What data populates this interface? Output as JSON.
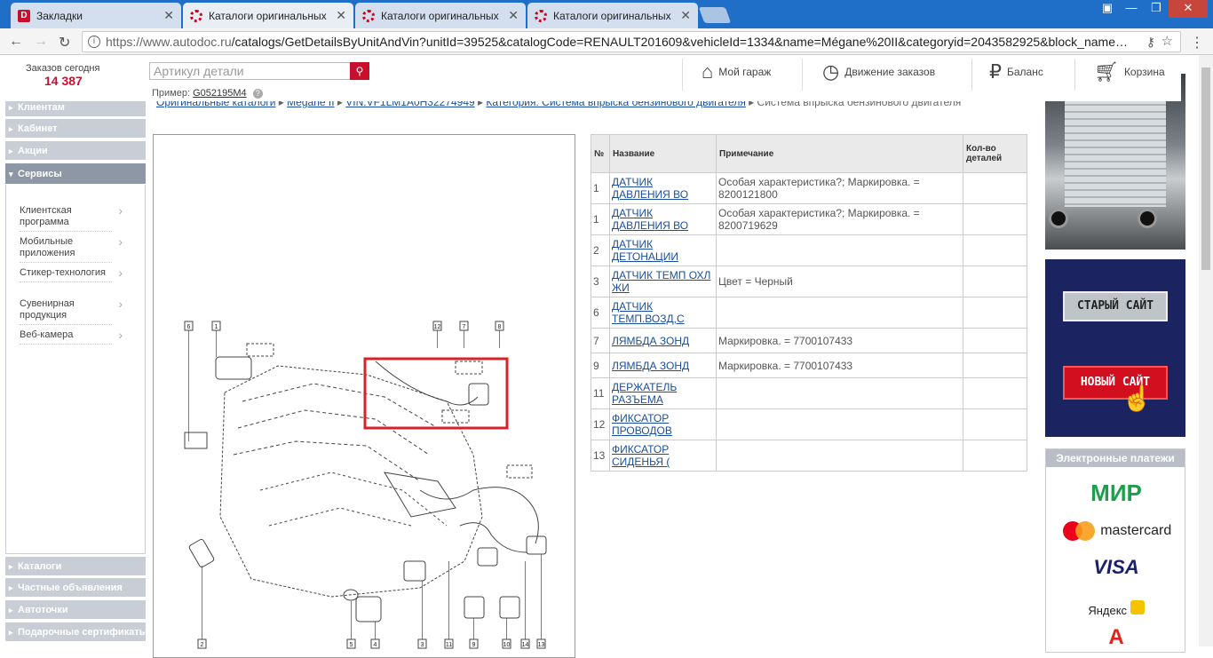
{
  "browser": {
    "tabs": [
      {
        "title": "Закладки",
        "favicon": "d-icon",
        "active": false
      },
      {
        "title": "Каталоги оригинальных",
        "favicon": "autodoc-icon",
        "active": true
      },
      {
        "title": "Каталоги оригинальных",
        "favicon": "autodoc-icon",
        "active": false
      },
      {
        "title": "Каталоги оригинальных",
        "favicon": "autodoc-icon",
        "active": false
      }
    ],
    "url_domain": "https://www.autodoc.ru",
    "url_path": "/catalogs/GetDetailsByUnitAndVin?unitId=39525&catalogCode=RENAULT201609&vehicleId=1334&name=Mégane%20II&categoryid=2043582925&block_name…"
  },
  "header": {
    "orders_label": "Заказов сегодня",
    "orders_count": "14 387",
    "search_placeholder": "Артикул детали",
    "example_label": "Пример:",
    "example_value": "G052195M4",
    "links": [
      {
        "label": "Мой гараж",
        "icon": "garage-icon"
      },
      {
        "label": "Движение заказов",
        "icon": "orders-clock-icon"
      },
      {
        "label": "Баланс",
        "icon": "wallet-icon"
      },
      {
        "label": "Корзина",
        "icon": "cart-icon"
      }
    ]
  },
  "sidebar": {
    "top_sections": [
      "Клиентам",
      "Кабинет",
      "Акции",
      "Сервисы"
    ],
    "service_items": [
      "Клиентская программа",
      "Мобильные приложения",
      "Стикер-технология",
      "Сувенирная продукция",
      "Веб-камера"
    ],
    "bottom_sections": [
      "Каталоги",
      "Частные объявления",
      "Автоточки",
      "Подарочные сертификаты"
    ]
  },
  "breadcrumb": {
    "items": [
      "Оригинальные каталоги",
      "Mégane II",
      "VIN:VF1LM1A0H32274949",
      "Категория: Система впрыска бензинового двигателя"
    ],
    "current": "Система впрыска бензинового двигателя"
  },
  "diagram": {
    "callouts": [
      "6",
      "1",
      "12",
      "7",
      "8",
      "2",
      "5",
      "4",
      "3",
      "11",
      "9",
      "10",
      "14",
      "13"
    ]
  },
  "table": {
    "headers": [
      "№",
      "Название",
      "Примечание",
      "Кол-во деталей"
    ],
    "rows": [
      {
        "num": "1",
        "name": "ДАТЧИК ДАВЛЕНИЯ ВО",
        "note": "Особая характеристика?; Маркировка. = 8200121800",
        "qty": ""
      },
      {
        "num": "1",
        "name": "ДАТЧИК ДАВЛЕНИЯ ВО",
        "note": "Особая характеристика?; Маркировка. = 8200719629",
        "qty": ""
      },
      {
        "num": "2",
        "name": "ДАТЧИК ДЕТОНАЦИИ",
        "note": "",
        "qty": ""
      },
      {
        "num": "3",
        "name": "ДАТЧИК ТЕМП ОХЛ ЖИ",
        "note": "Цвет = Черный",
        "qty": ""
      },
      {
        "num": "6",
        "name": "ДАТЧИК ТЕМП.ВОЗД,С",
        "note": "",
        "qty": ""
      },
      {
        "num": "7",
        "name": "ЛЯМБДА ЗОНД",
        "note": "Маркировка. = 7700107433",
        "qty": ""
      },
      {
        "num": "9",
        "name": "ЛЯМБДА ЗОНД",
        "note": "Маркировка. = 7700107433",
        "qty": ""
      },
      {
        "num": "11",
        "name": "ДЕРЖАТЕЛЬ РАЗЪЕМА",
        "note": "",
        "qty": ""
      },
      {
        "num": "12",
        "name": "ФИКСАТОР ПРОВОДОВ",
        "note": "",
        "qty": ""
      },
      {
        "num": "13",
        "name": "ФИКСАТОР СИДЕНЬЯ (",
        "note": "",
        "qty": ""
      }
    ]
  },
  "right": {
    "old_site": "СТАРЫЙ САЙТ",
    "new_site": "НОВЫЙ САЙТ",
    "payments_title": "Электронные платежи",
    "payment_logos": [
      "МИР",
      "mastercard",
      "VISA",
      "Яндекс",
      "A"
    ]
  },
  "colors": {
    "brand_red": "#c8102e",
    "link_blue": "#1a4e9c",
    "tabbar": "#1f6fc9"
  }
}
